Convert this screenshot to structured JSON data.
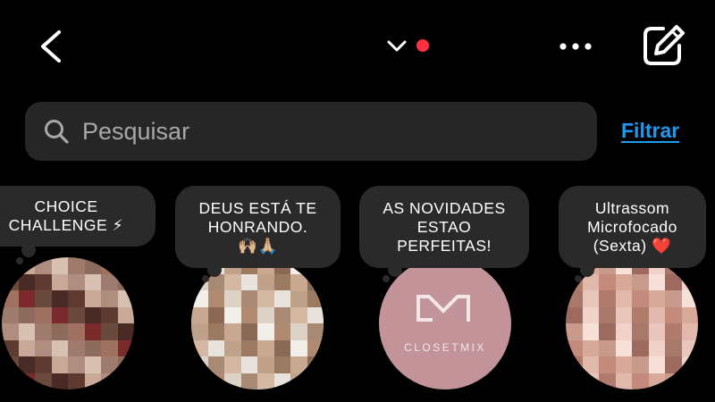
{
  "header": {
    "back_icon": "chevron-left-icon",
    "account_switch_icon": "chevron-down-icon",
    "notification_dot_color": "#ff3040",
    "more_icon": "ellipsis-horizontal-icon",
    "compose_icon": "edit-square-icon"
  },
  "search": {
    "icon": "search-icon",
    "placeholder": "Pesquisar"
  },
  "filter": {
    "label": "Filtrar",
    "color": "#1d9bf0"
  },
  "notes": [
    {
      "text": "CHOICE\nCHALLENGE ⚡",
      "avatar_type": "pixelated-photo"
    },
    {
      "text": "DEUS ESTÁ TE\nHONRANDO.\n🙌🏼🙏🏼",
      "avatar_type": "pixelated-photo"
    },
    {
      "text": "AS NOVIDADES\nESTAO\nPERFEITAS!",
      "avatar_type": "logo",
      "logo_text": "CLOSETMIX",
      "logo_color": "#c2949a"
    },
    {
      "text": "Ultrassom\nMicrofocado\n(Sexta) ❤️",
      "avatar_type": "pixelated-photo"
    }
  ]
}
